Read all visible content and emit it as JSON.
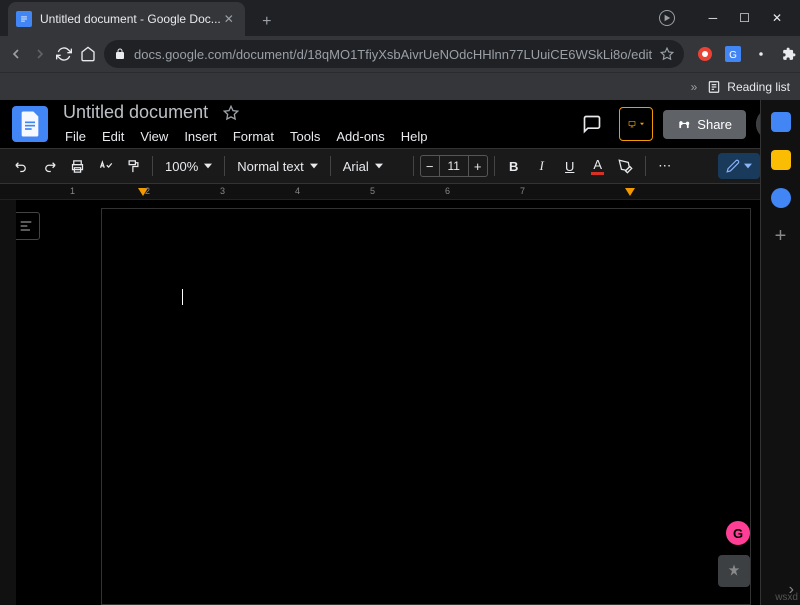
{
  "browser": {
    "tab_title": "Untitled document - Google Doc...",
    "url": "docs.google.com/document/d/18qMO1TfiyXsbAivrUeNOdcHHlnn77LUuiCE6WSkLi8o/edit",
    "reading_list_label": "Reading list"
  },
  "docs": {
    "title": "Untitled document",
    "menus": [
      "File",
      "Edit",
      "View",
      "Insert",
      "Format",
      "Tools",
      "Add-ons",
      "Help"
    ],
    "share_label": "Share",
    "zoom": "100%",
    "style": "Normal text",
    "font": "Arial",
    "font_size": "11",
    "ruler_numbers": [
      "1",
      "2",
      "3",
      "4",
      "5",
      "6",
      "7"
    ],
    "more_label": "⋯"
  },
  "watermark": "wsxd"
}
